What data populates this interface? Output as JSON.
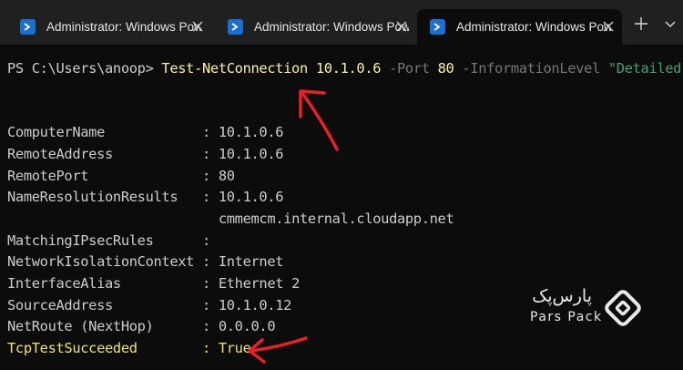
{
  "tabs": [
    {
      "title": "Administrator: Windows PowerShell",
      "active": false
    },
    {
      "title": "Administrator: Windows PowerShell",
      "active": false
    },
    {
      "title": "Administrator: Windows PowerShell",
      "active": true
    }
  ],
  "toolbar": {
    "new_tab_icon": "plus-icon",
    "menu_icon": "chevron-down-icon"
  },
  "terminal": {
    "prompt": "PS C:\\Users\\anoop> ",
    "command": {
      "name": "Test-NetConnection",
      "target": "10.1.0.6",
      "port_param": "-Port",
      "port_value": "80",
      "info_param": "-InformationLevel",
      "info_value": "\"Detailed\""
    },
    "output": [
      {
        "key": "ComputerName            ",
        "sep": ": ",
        "value": "10.1.0.6"
      },
      {
        "key": "RemoteAddress           ",
        "sep": ": ",
        "value": "10.1.0.6"
      },
      {
        "key": "RemotePort              ",
        "sep": ": ",
        "value": "80"
      },
      {
        "key": "NameResolutionResults   ",
        "sep": ": ",
        "value": "10.1.0.6"
      },
      {
        "key": "                          ",
        "sep": "",
        "value": "cmmemcm.internal.cloudapp.net"
      },
      {
        "key": "MatchingIPsecRules      ",
        "sep": ": ",
        "value": ""
      },
      {
        "key": "NetworkIsolationContext ",
        "sep": ": ",
        "value": "Internet"
      },
      {
        "key": "InterfaceAlias          ",
        "sep": ": ",
        "value": "Ethernet 2"
      },
      {
        "key": "SourceAddress           ",
        "sep": ": ",
        "value": "10.1.0.12"
      },
      {
        "key": "NetRoute (NextHop)      ",
        "sep": ": ",
        "value": "0.0.0.0"
      },
      {
        "key": "TcpTestSucceeded        ",
        "sep": ": ",
        "value": "True"
      }
    ]
  },
  "watermark": {
    "brand_fa": "پارس‌پک",
    "brand_en": "Pars Pack"
  },
  "colors": {
    "terminal_bg": "#0c0c0c",
    "tabbar_bg": "#202020",
    "highlight": "#f1e36b",
    "annotation": "#e8202a"
  }
}
